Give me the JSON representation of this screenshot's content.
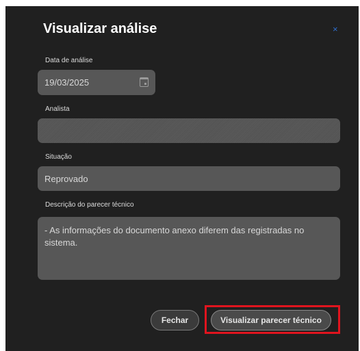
{
  "dialog": {
    "title": "Visualizar análise",
    "close_icon": "×"
  },
  "fields": {
    "date": {
      "label": "Data de análise",
      "value": "19/03/2025"
    },
    "analyst": {
      "label": "Analista",
      "value": ""
    },
    "status": {
      "label": "Situação",
      "value": "Reprovado"
    },
    "description": {
      "label": "Descrição do parecer técnico",
      "value": "- As informações do documento anexo diferem das registradas no sistema."
    }
  },
  "actions": {
    "close_label": "Fechar",
    "view_label": "Visualizar parecer técnico"
  },
  "colors": {
    "dialog_bg": "#202020",
    "field_bg": "#575757",
    "close_icon": "#2f6fcf",
    "highlight": "#e0141e"
  },
  "icons": {
    "date": "calendar-icon",
    "close": "close-icon"
  }
}
